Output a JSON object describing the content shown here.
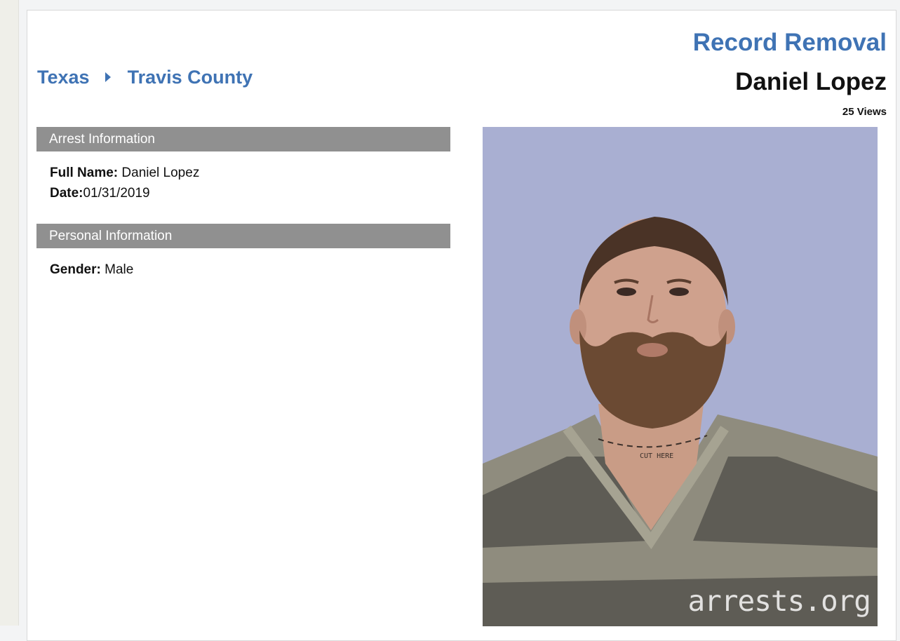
{
  "breadcrumb": {
    "state": "Texas",
    "county": "Travis County"
  },
  "header": {
    "record_removal": "Record Removal",
    "name": "Daniel Lopez",
    "views": "25 Views"
  },
  "arrest_info": {
    "title": "Arrest Information",
    "full_name_label": "Full Name:",
    "full_name_value": " Daniel Lopez",
    "date_label": "Date:",
    "date_value": "01/31/2019"
  },
  "personal_info": {
    "title": "Personal Information",
    "gender_label": "Gender:",
    "gender_value": " Male"
  },
  "photo": {
    "watermark": "arrests.org",
    "neck_tattoo": "CUT HERE"
  }
}
